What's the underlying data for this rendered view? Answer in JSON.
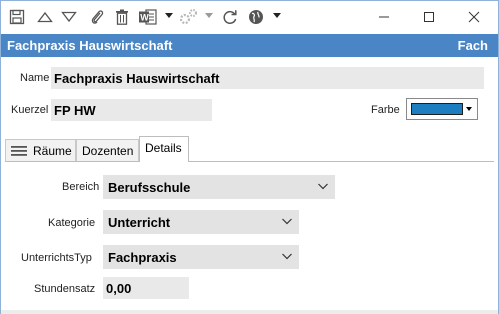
{
  "toolbar": {
    "icons": [
      "save-icon",
      "move-up-icon",
      "move-down-icon",
      "attachment-icon",
      "delete-icon",
      "word-export-icon",
      "workflow-icon",
      "refresh-icon",
      "globe-icon"
    ]
  },
  "window": {
    "minimize": "—",
    "maximize": "☐",
    "close": "✕"
  },
  "header": {
    "title": "Fachpraxis Hauswirtschaft",
    "type": "Fach"
  },
  "form": {
    "name_label": "Name",
    "name_value": "Fachpraxis Hauswirtschaft",
    "kuerzel_label": "Kuerzel",
    "kuerzel_value": "FP HW",
    "farbe_label": "Farbe",
    "farbe_color": "#1c7ec1"
  },
  "tabs": [
    {
      "label": "Räume"
    },
    {
      "label": "Dozenten"
    },
    {
      "label": "Details"
    }
  ],
  "details": {
    "bereich_label": "Bereich",
    "bereich_value": "Berufsschule",
    "kategorie_label": "Kategorie",
    "kategorie_value": "Unterricht",
    "unterrichtstyp_label": "UnterrichtsTyp",
    "unterrichtstyp_value": "Fachpraxis",
    "stundensatz_label": "Stundensatz",
    "stundensatz_value": "0,00"
  },
  "colors": {
    "header_bg": "#4a86c5",
    "accent": "#1c7ec1"
  }
}
